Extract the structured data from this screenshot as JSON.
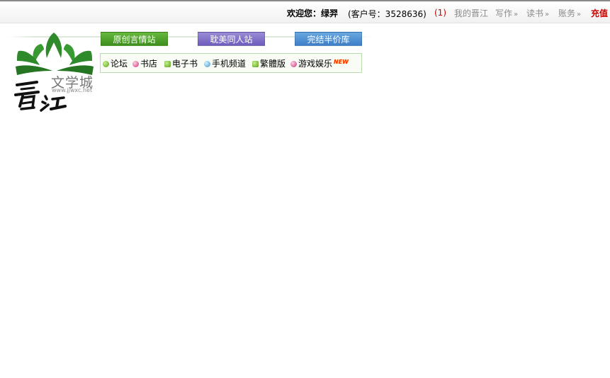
{
  "topbar": {
    "welcome_prefix": "欢迎您：",
    "username": "绿羿",
    "customer_id_text": "(客户号：3528636)",
    "message_count": "(1)",
    "links": [
      {
        "label": "我的晋江"
      },
      {
        "label": "写作",
        "arrow": "»"
      },
      {
        "label": "读书",
        "arrow": "»"
      },
      {
        "label": "账务",
        "arrow": "»"
      }
    ],
    "recharge_label": "充值"
  },
  "logo": {
    "cn_text": "文学城",
    "domain_text": "www.jjwxc.net",
    "calligraphy_text": "晋江",
    "colors": {
      "leaves": "#2e8a2a",
      "ink": "#111111"
    }
  },
  "tabs": [
    {
      "label": "原创言情站",
      "color": "#4fa22b"
    },
    {
      "label": "耽美同人站",
      "color": "#7f6cc8"
    },
    {
      "label": "完结半价库",
      "color": "#4f90d4"
    }
  ],
  "channels": [
    {
      "label": "论坛",
      "icon": "green-dot-icon"
    },
    {
      "label": "书店",
      "icon": "pink-dot-icon"
    },
    {
      "label": "电子书",
      "icon": "green-square-icon"
    },
    {
      "label": "手机频道",
      "icon": "blue-dot-icon"
    },
    {
      "label": "繁體版",
      "icon": "green-square-icon"
    },
    {
      "label": "游戏娱乐",
      "icon": "pink-dot-icon",
      "badge": "NEW"
    }
  ]
}
